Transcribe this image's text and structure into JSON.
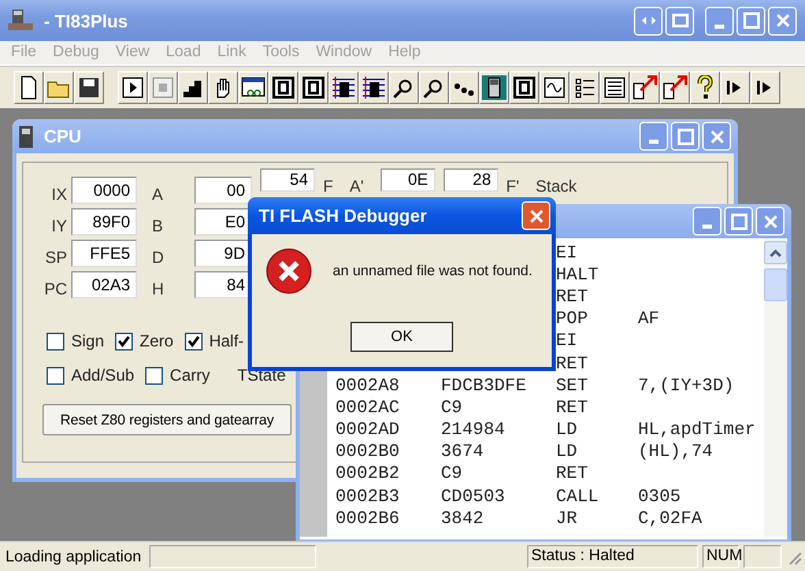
{
  "window": {
    "title": "- TI83Plus"
  },
  "menu": [
    {
      "label": "File",
      "disabled": true
    },
    {
      "label": "Debug",
      "disabled": true
    },
    {
      "label": "View",
      "disabled": true
    },
    {
      "label": "Load",
      "disabled": true
    },
    {
      "label": "Link",
      "disabled": true
    },
    {
      "label": "Tools",
      "disabled": true
    },
    {
      "label": "Window",
      "disabled": true
    },
    {
      "label": "Help",
      "disabled": true
    }
  ],
  "cpu_window": {
    "title": "CPU",
    "registers": [
      {
        "label": "IX",
        "value": "0000",
        "label2": "A",
        "value2": "00"
      },
      {
        "label": "IY",
        "value": "89F0",
        "label2": "B",
        "value2": "E0"
      },
      {
        "label": "SP",
        "value": "FFE5",
        "label2": "D",
        "value2": "9D"
      },
      {
        "label": "PC",
        "value": "02A3",
        "label2": "H",
        "value2": "84"
      }
    ],
    "top_extras": [
      {
        "kind": "field",
        "text": "54"
      },
      {
        "kind": "label",
        "text": "F"
      },
      {
        "kind": "label",
        "text": "A'"
      },
      {
        "kind": "field",
        "text": "0E"
      },
      {
        "kind": "field",
        "text": "28"
      },
      {
        "kind": "label",
        "text": "F'"
      },
      {
        "kind": "label",
        "text": "Stack"
      }
    ],
    "flags_row1": [
      {
        "label": "Sign",
        "checked": false
      },
      {
        "label": "Zero",
        "checked": true
      },
      {
        "label": "Half-",
        "checked": true
      }
    ],
    "flags_row2": [
      {
        "label": "Add/Sub",
        "checked": false
      },
      {
        "label": "Carry",
        "checked": false
      }
    ],
    "tstates_label": "TState",
    "reset_button": "Reset Z80 registers and gatearray"
  },
  "disassembly_window": {
    "rows": [
      {
        "mnemonic": "EI"
      },
      {
        "mnemonic": "HALT"
      },
      {
        "mnemonic": "RET"
      },
      {
        "mnemonic": "POP",
        "operand": "AF"
      },
      {
        "mnemonic": "EI"
      },
      {
        "mnemonic": "RET"
      },
      {
        "address": "0002A8",
        "bytes": "FDCB3DFE",
        "mnemonic": "SET",
        "operand": "7,(IY+3D)"
      },
      {
        "address": "0002AC",
        "bytes": "C9",
        "mnemonic": "RET"
      },
      {
        "address": "0002AD",
        "bytes": "214984",
        "mnemonic": "LD",
        "operand": "HL,apdTimer"
      },
      {
        "address": "0002B0",
        "bytes": "3674",
        "mnemonic": "LD",
        "operand": "(HL),74"
      },
      {
        "address": "0002B2",
        "bytes": "C9",
        "mnemonic": "RET"
      },
      {
        "address": "0002B3",
        "bytes": "CD0503",
        "mnemonic": "CALL",
        "operand": "0305"
      },
      {
        "address": "0002B6",
        "bytes": "3842",
        "mnemonic": "JR",
        "operand": "C,02FA"
      }
    ]
  },
  "dialog": {
    "title": "TI FLASH Debugger",
    "message": "an unnamed file was not found.",
    "button": "OK"
  },
  "status_bar": {
    "message": "Loading application",
    "status": "Status : Halted",
    "indicator": "NUM"
  }
}
